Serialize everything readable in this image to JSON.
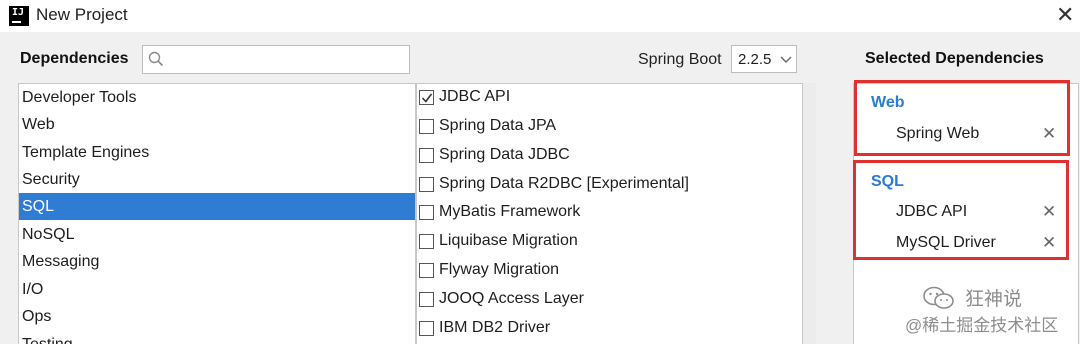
{
  "window": {
    "title": "New Project",
    "app_icon_text": "IJ"
  },
  "dependencies_label": "Dependencies",
  "search": {
    "placeholder": ""
  },
  "spring_boot": {
    "label": "Spring Boot",
    "value": "2.2.5"
  },
  "selected_label": "Selected Dependencies",
  "categories": [
    {
      "label": "Developer Tools"
    },
    {
      "label": "Web"
    },
    {
      "label": "Template Engines"
    },
    {
      "label": "Security"
    },
    {
      "label": "SQL",
      "selected": true
    },
    {
      "label": "NoSQL"
    },
    {
      "label": "Messaging"
    },
    {
      "label": "I/O"
    },
    {
      "label": "Ops"
    },
    {
      "label": "Testing"
    }
  ],
  "dependencies": [
    {
      "label": "JDBC API",
      "checked": true
    },
    {
      "label": "Spring Data JPA",
      "checked": false
    },
    {
      "label": "Spring Data JDBC",
      "checked": false
    },
    {
      "label": "Spring Data R2DBC [Experimental]",
      "checked": false
    },
    {
      "label": "MyBatis Framework",
      "checked": false
    },
    {
      "label": "Liquibase Migration",
      "checked": false
    },
    {
      "label": "Flyway Migration",
      "checked": false
    },
    {
      "label": "JOOQ Access Layer",
      "checked": false
    },
    {
      "label": "IBM DB2 Driver",
      "checked": false
    }
  ],
  "selected_groups": [
    {
      "name": "Web",
      "items": [
        "Spring Web"
      ]
    },
    {
      "name": "SQL",
      "items": [
        "JDBC API",
        "MySQL Driver"
      ]
    }
  ],
  "watermark": {
    "line1": "狂神说",
    "line2": "@稀土掘金技术社区"
  },
  "colors": {
    "selection": "#2e7cd3",
    "group_header": "#2a7bd1",
    "highlight_box": "#e03030"
  },
  "icons": {
    "search": "search-icon",
    "dropdown": "chevron-down-icon",
    "close": "close-icon",
    "remove": "remove-icon",
    "checkbox": "checkmark-icon"
  }
}
